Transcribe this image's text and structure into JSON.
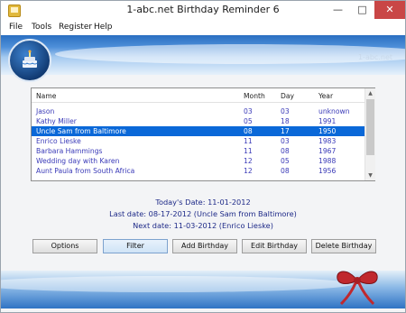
{
  "window": {
    "title": "1-abc.net Birthday Reminder 6",
    "minimize": "—",
    "maximize": "□",
    "close": "✕"
  },
  "menu": [
    "File",
    "Tools",
    "Register",
    "Help"
  ],
  "banner": {
    "logo_text": "1-abc.net"
  },
  "list": {
    "columns": [
      "Name",
      "Month",
      "Day",
      "Year"
    ],
    "rows": [
      {
        "name": "Jason",
        "month": "03",
        "day": "03",
        "year": "unknown"
      },
      {
        "name": "Kathy Miller",
        "month": "05",
        "day": "18",
        "year": "1991"
      },
      {
        "name": "Uncle Sam from Baltimore",
        "month": "08",
        "day": "17",
        "year": "1950"
      },
      {
        "name": "Enrico Lieske",
        "month": "11",
        "day": "03",
        "year": "1983"
      },
      {
        "name": "Barbara Hammings",
        "month": "11",
        "day": "08",
        "year": "1967"
      },
      {
        "name": "Wedding day with Karen",
        "month": "12",
        "day": "05",
        "year": "1988"
      },
      {
        "name": "Aunt Paula from South Africa",
        "month": "12",
        "day": "08",
        "year": "1956"
      }
    ],
    "selected_index": 2
  },
  "info": {
    "today": "Today's Date:  11-01-2012",
    "last": "Last date:  08-17-2012  (Uncle Sam from Baltimore)",
    "next": "Next date:  11-03-2012  (Enrico Lieske)"
  },
  "buttons": {
    "options": "Options",
    "filter": "Filter",
    "add": "Add Birthday",
    "edit": "Edit Birthday",
    "delete": "Delete Birthday"
  },
  "colors": {
    "selected_row": "#0a68d8",
    "list_text": "#3a3ab8",
    "info_text": "#1e2a88",
    "banner_blue": "#2a6fc1",
    "bow_red": "#c0282e"
  }
}
